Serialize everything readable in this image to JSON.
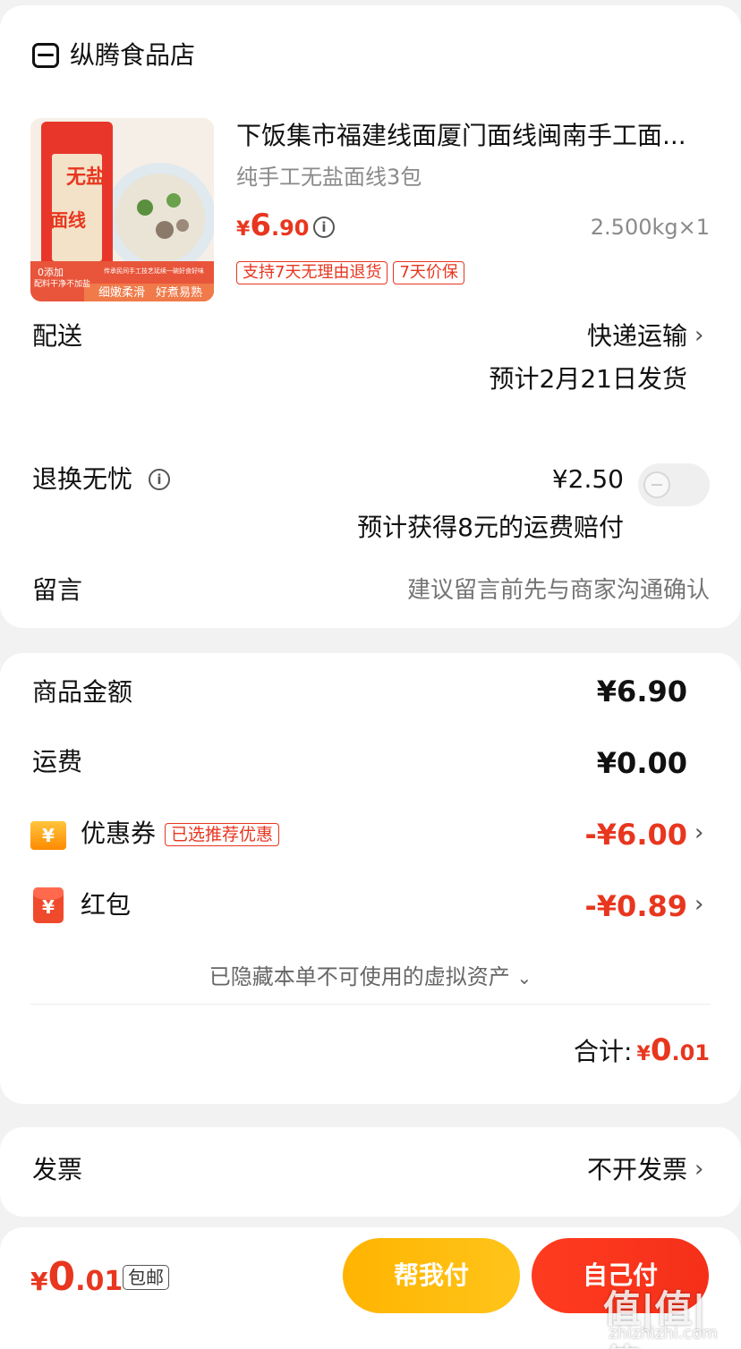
{
  "shop": {
    "name": "纵腾食品店",
    "product": {
      "title": "下饭集市福建线面厦门面线闽南手工面...",
      "spec": "纯手工无盐面线3包",
      "price_symbol": "¥",
      "price_int": "6",
      "price_dec": ".90",
      "weight_qty": "2.500kg×1",
      "tags": [
        "支持7天无理由退货",
        "7天价保"
      ],
      "image": {
        "big_text_1": "无盐",
        "big_text_2": "面线",
        "badge_1": "0添加",
        "badge_2": "配料干净不加盐",
        "banner_small": "传承民间手工技艺延续一碗好食好味",
        "banner_1": "细嫩柔滑",
        "banner_2": "好煮易熟"
      }
    },
    "delivery": {
      "label": "配送",
      "method": "快递运输",
      "eta": "预计2月21日发货"
    },
    "return_service": {
      "label": "退换无忧",
      "price": "¥2.50",
      "toggle_on": false,
      "note": "预计获得8元的运费赔付"
    },
    "message": {
      "label": "留言",
      "placeholder": "建议留言前先与商家沟通确认"
    }
  },
  "summary": {
    "goods_label": "商品金额",
    "goods_value": "¥6.90",
    "shipping_label": "运费",
    "shipping_value": "¥0.00",
    "coupon_label": "优惠券",
    "coupon_icon": "¥",
    "coupon_tag": "已选推荐优惠",
    "coupon_value": "-¥6.00",
    "redpacket_label": "红包",
    "redpacket_icon": "¥",
    "redpacket_value": "-¥0.89",
    "hidden_assets": "已隐藏本单不可使用的虚拟资产",
    "total_label": "合计:",
    "total_symbol": "¥",
    "total_int": "0",
    "total_dec": ".01"
  },
  "invoice": {
    "label": "发票",
    "value": "不开发票"
  },
  "bottom_bar": {
    "price_symbol": "¥",
    "price_int": "0",
    "price_dec": ".01",
    "baoyou": "包邮",
    "help_pay": "帮我付",
    "self_pay": "自己付"
  },
  "watermark": {
    "main": "值|值|值",
    "sub": "zhizhizhi.com"
  },
  "colors": {
    "accent_red": "#e8361f",
    "help_btn": "#ffb400",
    "self_btn": "#f5301a"
  }
}
